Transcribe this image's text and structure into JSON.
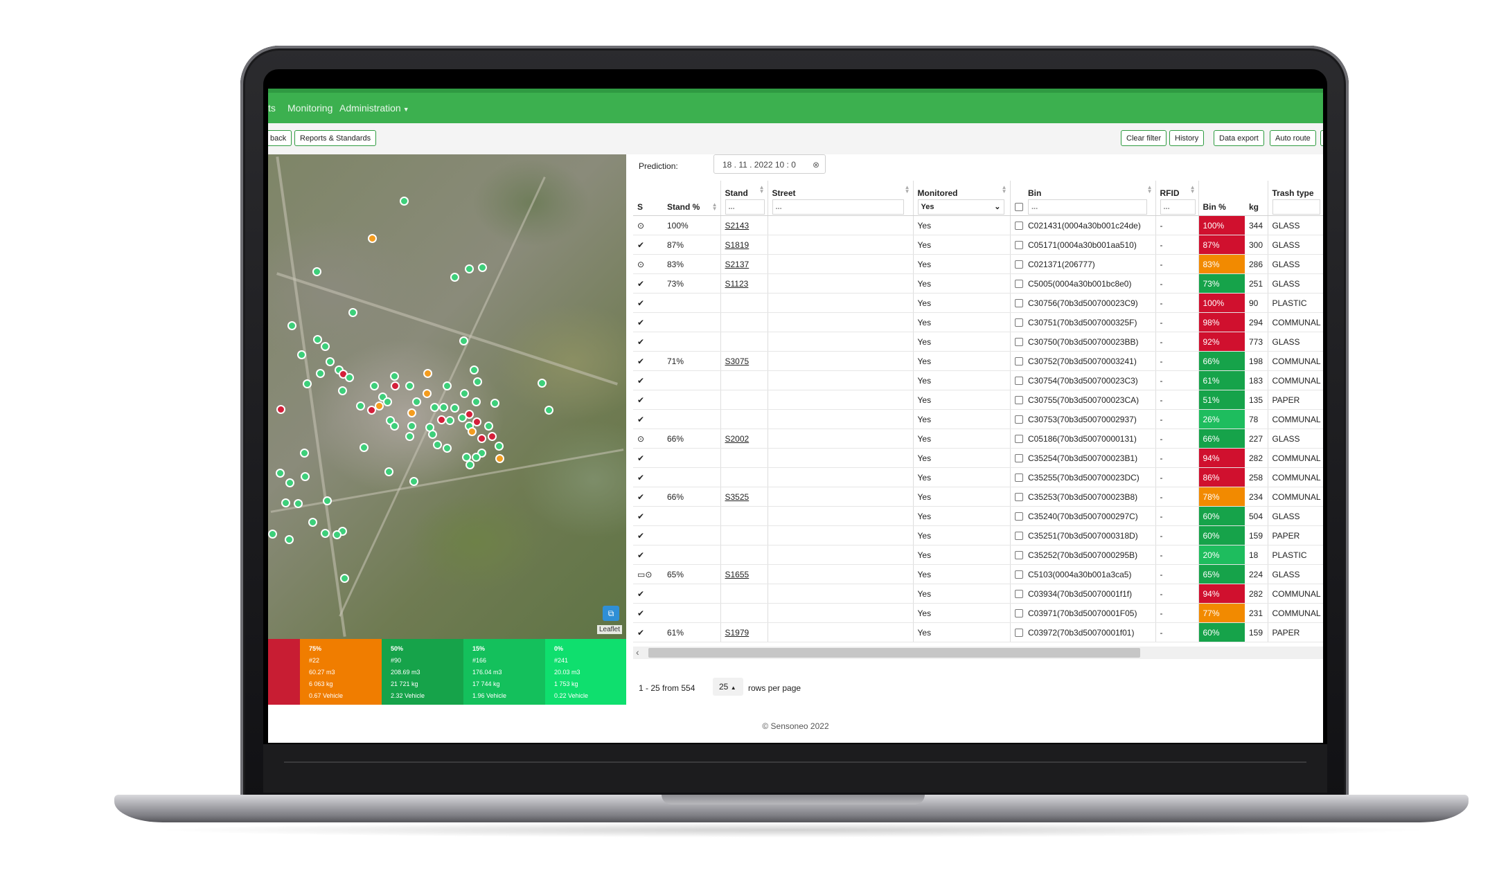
{
  "nav": {
    "items": [
      "ts",
      "Monitoring",
      "Administration"
    ]
  },
  "toolbar": {
    "left_buttons": [
      "back",
      "Reports & Standards"
    ],
    "right_buttons": [
      "Clear filter",
      "History",
      "Data export",
      "Auto route"
    ]
  },
  "map": {
    "attribution": "Leaflet",
    "layers_icon": "layers-icon"
  },
  "legend": [
    {
      "value": "75%",
      "count": "#22",
      "volume": "60.27 m3",
      "weight": "6 063 kg",
      "vehicles": "0.67 Vehicle",
      "color": "#f07d00"
    },
    {
      "value": "50%",
      "count": "#90",
      "volume": "208.69 m3",
      "weight": "21 721 kg",
      "vehicles": "2.32 Vehicle",
      "color": "#16a34a"
    },
    {
      "value": "15%",
      "count": "#166",
      "volume": "176.04 m3",
      "weight": "17 744 kg",
      "vehicles": "1.96 Vehicle",
      "color": "#14c05c"
    },
    {
      "value": "0%",
      "count": "#241",
      "volume": "20.03 m3",
      "weight": "1 753 kg",
      "vehicles": "0.22 Vehicle",
      "color": "#0fdf6e"
    }
  ],
  "prediction": {
    "label": "Prediction:",
    "value": "18 . 11 . 2022  10 : 0",
    "clear_icon": "clear-icon"
  },
  "table": {
    "headers": {
      "s": "S",
      "stand_pct": "Stand %",
      "stand": "Stand",
      "street": "Street",
      "monitored": "Monitored",
      "bin": "Bin",
      "rfid": "RFID",
      "bin_pct": "Bin %",
      "kg": "kg",
      "trash_type": "Trash type"
    },
    "filters": {
      "stand": "...",
      "street": "...",
      "monitored": "Yes",
      "bin": "...",
      "rfid": "..."
    },
    "rows": [
      {
        "s": "clock",
        "stand_pct": "100%",
        "stand": "S2143",
        "street": "",
        "monitored": "Yes",
        "bin": "C021431(0004a30b001c24de)",
        "rfid": "-",
        "bin_pct": "100%",
        "pct_class": "red",
        "kg": "344",
        "type": "GLASS"
      },
      {
        "s": "check",
        "stand_pct": "87%",
        "stand": "S1819",
        "street": "",
        "monitored": "Yes",
        "bin": "C05171(0004a30b001aa510)",
        "rfid": "-",
        "bin_pct": "87%",
        "pct_class": "red",
        "kg": "300",
        "type": "GLASS"
      },
      {
        "s": "clock",
        "stand_pct": "83%",
        "stand": "S2137",
        "street": "",
        "monitored": "Yes",
        "bin": "C021371(206777)",
        "rfid": "-",
        "bin_pct": "83%",
        "pct_class": "orange",
        "kg": "286",
        "type": "GLASS"
      },
      {
        "s": "check",
        "stand_pct": "73%",
        "stand": "S1123",
        "street": "",
        "monitored": "Yes",
        "bin": "C5005(0004a30b001bc8e0)",
        "rfid": "-",
        "bin_pct": "73%",
        "pct_class": "green",
        "kg": "251",
        "type": "GLASS"
      },
      {
        "s": "check",
        "stand_pct": "",
        "stand": "",
        "street": "",
        "monitored": "Yes",
        "bin": "C30756(70b3d500700023C9)",
        "rfid": "-",
        "bin_pct": "100%",
        "pct_class": "red",
        "kg": "90",
        "type": "PLASTIC"
      },
      {
        "s": "check",
        "stand_pct": "",
        "stand": "",
        "street": "",
        "monitored": "Yes",
        "bin": "C30751(70b3d5007000325F)",
        "rfid": "-",
        "bin_pct": "98%",
        "pct_class": "red",
        "kg": "294",
        "type": "COMMUNAL"
      },
      {
        "s": "check",
        "stand_pct": "",
        "stand": "",
        "street": "",
        "monitored": "Yes",
        "bin": "C30750(70b3d500700023BB)",
        "rfid": "-",
        "bin_pct": "92%",
        "pct_class": "red",
        "kg": "773",
        "type": "GLASS"
      },
      {
        "s": "check",
        "stand_pct": "71%",
        "stand": "S3075",
        "street": "",
        "monitored": "Yes",
        "bin": "C30752(70b3d50070003241)",
        "rfid": "-",
        "bin_pct": "66%",
        "pct_class": "green",
        "kg": "198",
        "type": "COMMUNAL"
      },
      {
        "s": "check",
        "stand_pct": "",
        "stand": "",
        "street": "",
        "monitored": "Yes",
        "bin": "C30754(70b3d500700023C3)",
        "rfid": "-",
        "bin_pct": "61%",
        "pct_class": "green",
        "kg": "183",
        "type": "COMMUNAL"
      },
      {
        "s": "check",
        "stand_pct": "",
        "stand": "",
        "street": "",
        "monitored": "Yes",
        "bin": "C30755(70b3d500700023CA)",
        "rfid": "-",
        "bin_pct": "51%",
        "pct_class": "green",
        "kg": "135",
        "type": "PAPER"
      },
      {
        "s": "check",
        "stand_pct": "",
        "stand": "",
        "street": "",
        "monitored": "Yes",
        "bin": "C30753(70b3d50070002937)",
        "rfid": "-",
        "bin_pct": "26%",
        "pct_class": "lgreen",
        "kg": "78",
        "type": "COMMUNAL"
      },
      {
        "s": "clock",
        "stand_pct": "66%",
        "stand": "S2002",
        "street": "",
        "monitored": "Yes",
        "bin": "C05186(70b3d50070000131)",
        "rfid": "-",
        "bin_pct": "66%",
        "pct_class": "green",
        "kg": "227",
        "type": "GLASS"
      },
      {
        "s": "check",
        "stand_pct": "",
        "stand": "",
        "street": "",
        "monitored": "Yes",
        "bin": "C35254(70b3d500700023B1)",
        "rfid": "-",
        "bin_pct": "94%",
        "pct_class": "red",
        "kg": "282",
        "type": "COMMUNAL"
      },
      {
        "s": "check",
        "stand_pct": "",
        "stand": "",
        "street": "",
        "monitored": "Yes",
        "bin": "C35255(70b3d500700023DC)",
        "rfid": "-",
        "bin_pct": "86%",
        "pct_class": "red",
        "kg": "258",
        "type": "COMMUNAL"
      },
      {
        "s": "check",
        "stand_pct": "66%",
        "stand": "S3525",
        "street": "",
        "monitored": "Yes",
        "bin": "C35253(70b3d500700023B8)",
        "rfid": "-",
        "bin_pct": "78%",
        "pct_class": "orange",
        "kg": "234",
        "type": "COMMUNAL"
      },
      {
        "s": "check",
        "stand_pct": "",
        "stand": "",
        "street": "",
        "monitored": "Yes",
        "bin": "C35240(70b3d5007000297C)",
        "rfid": "-",
        "bin_pct": "60%",
        "pct_class": "green",
        "kg": "504",
        "type": "GLASS"
      },
      {
        "s": "check",
        "stand_pct": "",
        "stand": "",
        "street": "",
        "monitored": "Yes",
        "bin": "C35251(70b3d5007000318D)",
        "rfid": "-",
        "bin_pct": "60%",
        "pct_class": "green",
        "kg": "159",
        "type": "PAPER"
      },
      {
        "s": "check",
        "stand_pct": "",
        "stand": "",
        "street": "",
        "monitored": "Yes",
        "bin": "C35252(70b3d5007000295B)",
        "rfid": "-",
        "bin_pct": "20%",
        "pct_class": "lgreen",
        "kg": "18",
        "type": "PLASTIC"
      },
      {
        "s": "box-clock",
        "stand_pct": "65%",
        "stand": "S1655",
        "street": "",
        "monitored": "Yes",
        "bin": "C5103(0004a30b001a3ca5)",
        "rfid": "-",
        "bin_pct": "65%",
        "pct_class": "green",
        "kg": "224",
        "type": "GLASS"
      },
      {
        "s": "check",
        "stand_pct": "",
        "stand": "",
        "street": "",
        "monitored": "Yes",
        "bin": "C03934(70b3d50070001f1f)",
        "rfid": "-",
        "bin_pct": "94%",
        "pct_class": "red",
        "kg": "282",
        "type": "COMMUNAL"
      },
      {
        "s": "check",
        "stand_pct": "",
        "stand": "",
        "street": "",
        "monitored": "Yes",
        "bin": "C03971(70b3d50070001F05)",
        "rfid": "-",
        "bin_pct": "77%",
        "pct_class": "orange",
        "kg": "231",
        "type": "COMMUNAL"
      },
      {
        "s": "check",
        "stand_pct": "61%",
        "stand": "S1979",
        "street": "",
        "monitored": "Yes",
        "bin": "C03972(70b3d50070001f01)",
        "rfid": "-",
        "bin_pct": "60%",
        "pct_class": "green",
        "kg": "159",
        "type": "PAPER"
      }
    ]
  },
  "pagination": {
    "info": "1 - 25 from 554",
    "per_page": "25",
    "per_page_label": "rows per page"
  },
  "footer": {
    "copyright": "© Sensoneo 2022"
  }
}
